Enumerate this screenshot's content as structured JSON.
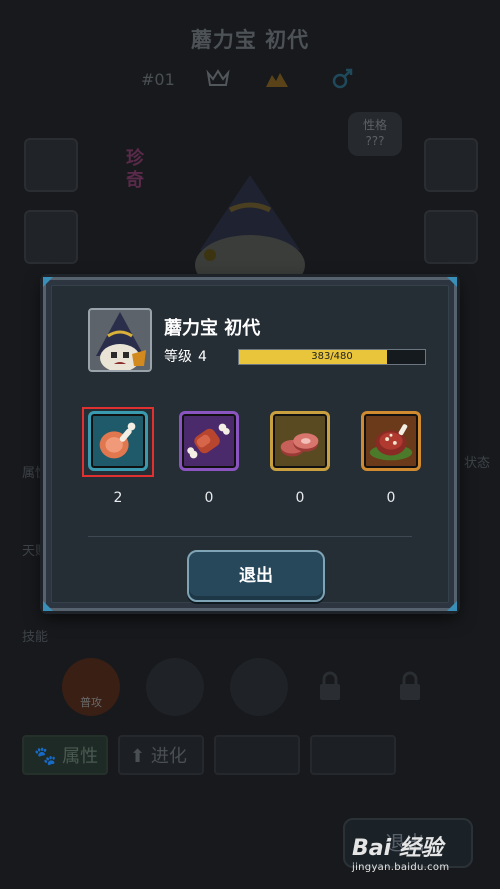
{
  "background": {
    "title": "蘑力宝 初代",
    "id": "#01",
    "trait_label": "性格",
    "trait_value": "???",
    "rarity": "珍奇",
    "labels": {
      "attributes": "属性",
      "talent": "天赋",
      "skills": "技能",
      "status": "状态"
    },
    "skill_name": "普攻",
    "buttons": {
      "attributes": "属性",
      "evolve": "进化",
      "exit": "退出"
    }
  },
  "dialog": {
    "pet_name": "蘑力宝 初代",
    "level_label": "等级",
    "level": "4",
    "xp_text": "383/480",
    "xp_fraction": 0.798,
    "foods": [
      {
        "name": "ham-food",
        "count": "2",
        "frame": "#3a9ab0",
        "bg": "#1e5a6a"
      },
      {
        "name": "meat-bone-food",
        "count": "0",
        "frame": "#8a55c0",
        "bg": "#4a2a6a"
      },
      {
        "name": "steak-slices-food",
        "count": "0",
        "frame": "#c8a040",
        "bg": "#5a4a22"
      },
      {
        "name": "roast-platter-food",
        "count": "0",
        "frame": "#d08a30",
        "bg": "#6a3a1a"
      }
    ],
    "exit_label": "退出"
  },
  "watermark": {
    "logo": "Bai 经验",
    "url": "jingyan.baidu.com"
  }
}
